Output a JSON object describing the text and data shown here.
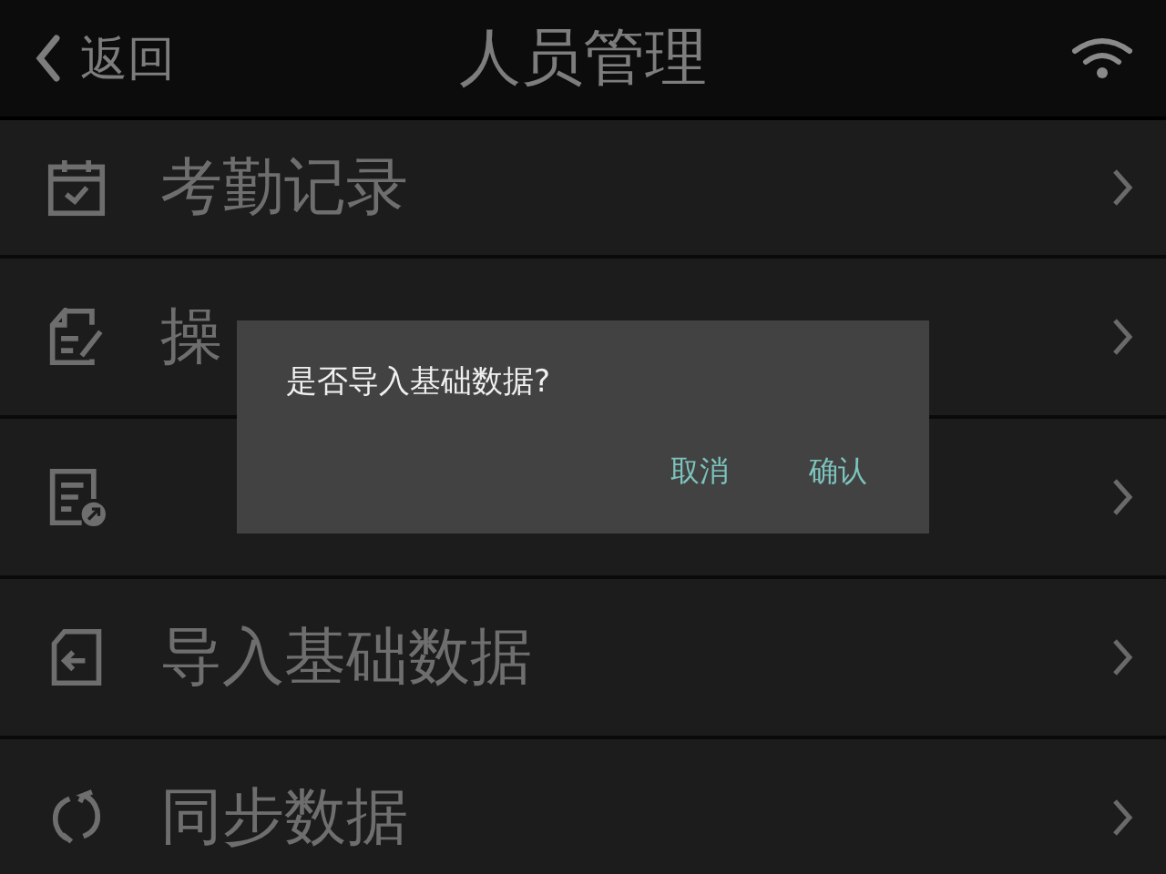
{
  "header": {
    "back_label": "返回",
    "title": "人员管理"
  },
  "menu": [
    {
      "kind": "calendar",
      "label": "考勤记录"
    },
    {
      "kind": "edit",
      "label": "操"
    },
    {
      "kind": "export"
    },
    {
      "kind": "import",
      "label": "导入基础数据"
    },
    {
      "kind": "sync",
      "label": "同步数据"
    }
  ],
  "dialog": {
    "message": "是否导入基础数据?",
    "buttons": [
      "取消",
      "确认"
    ]
  }
}
